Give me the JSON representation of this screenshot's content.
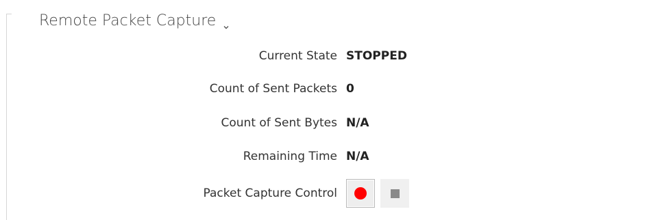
{
  "section": {
    "title": "Remote Packet Capture",
    "chevron_icon": "chevron-down-icon"
  },
  "status": {
    "current_state": {
      "label": "Current State",
      "value": "STOPPED"
    },
    "sent_packets": {
      "label": "Count of Sent Packets",
      "value": "0"
    },
    "sent_bytes": {
      "label": "Count of Sent Bytes",
      "value": "N/A"
    },
    "remaining_time": {
      "label": "Remaining Time",
      "value": "N/A"
    }
  },
  "control": {
    "label": "Packet Capture Control",
    "record_icon": "record-icon",
    "stop_icon": "stop-icon",
    "record_color": "#ff0000",
    "stop_color": "#8a8a8a"
  }
}
